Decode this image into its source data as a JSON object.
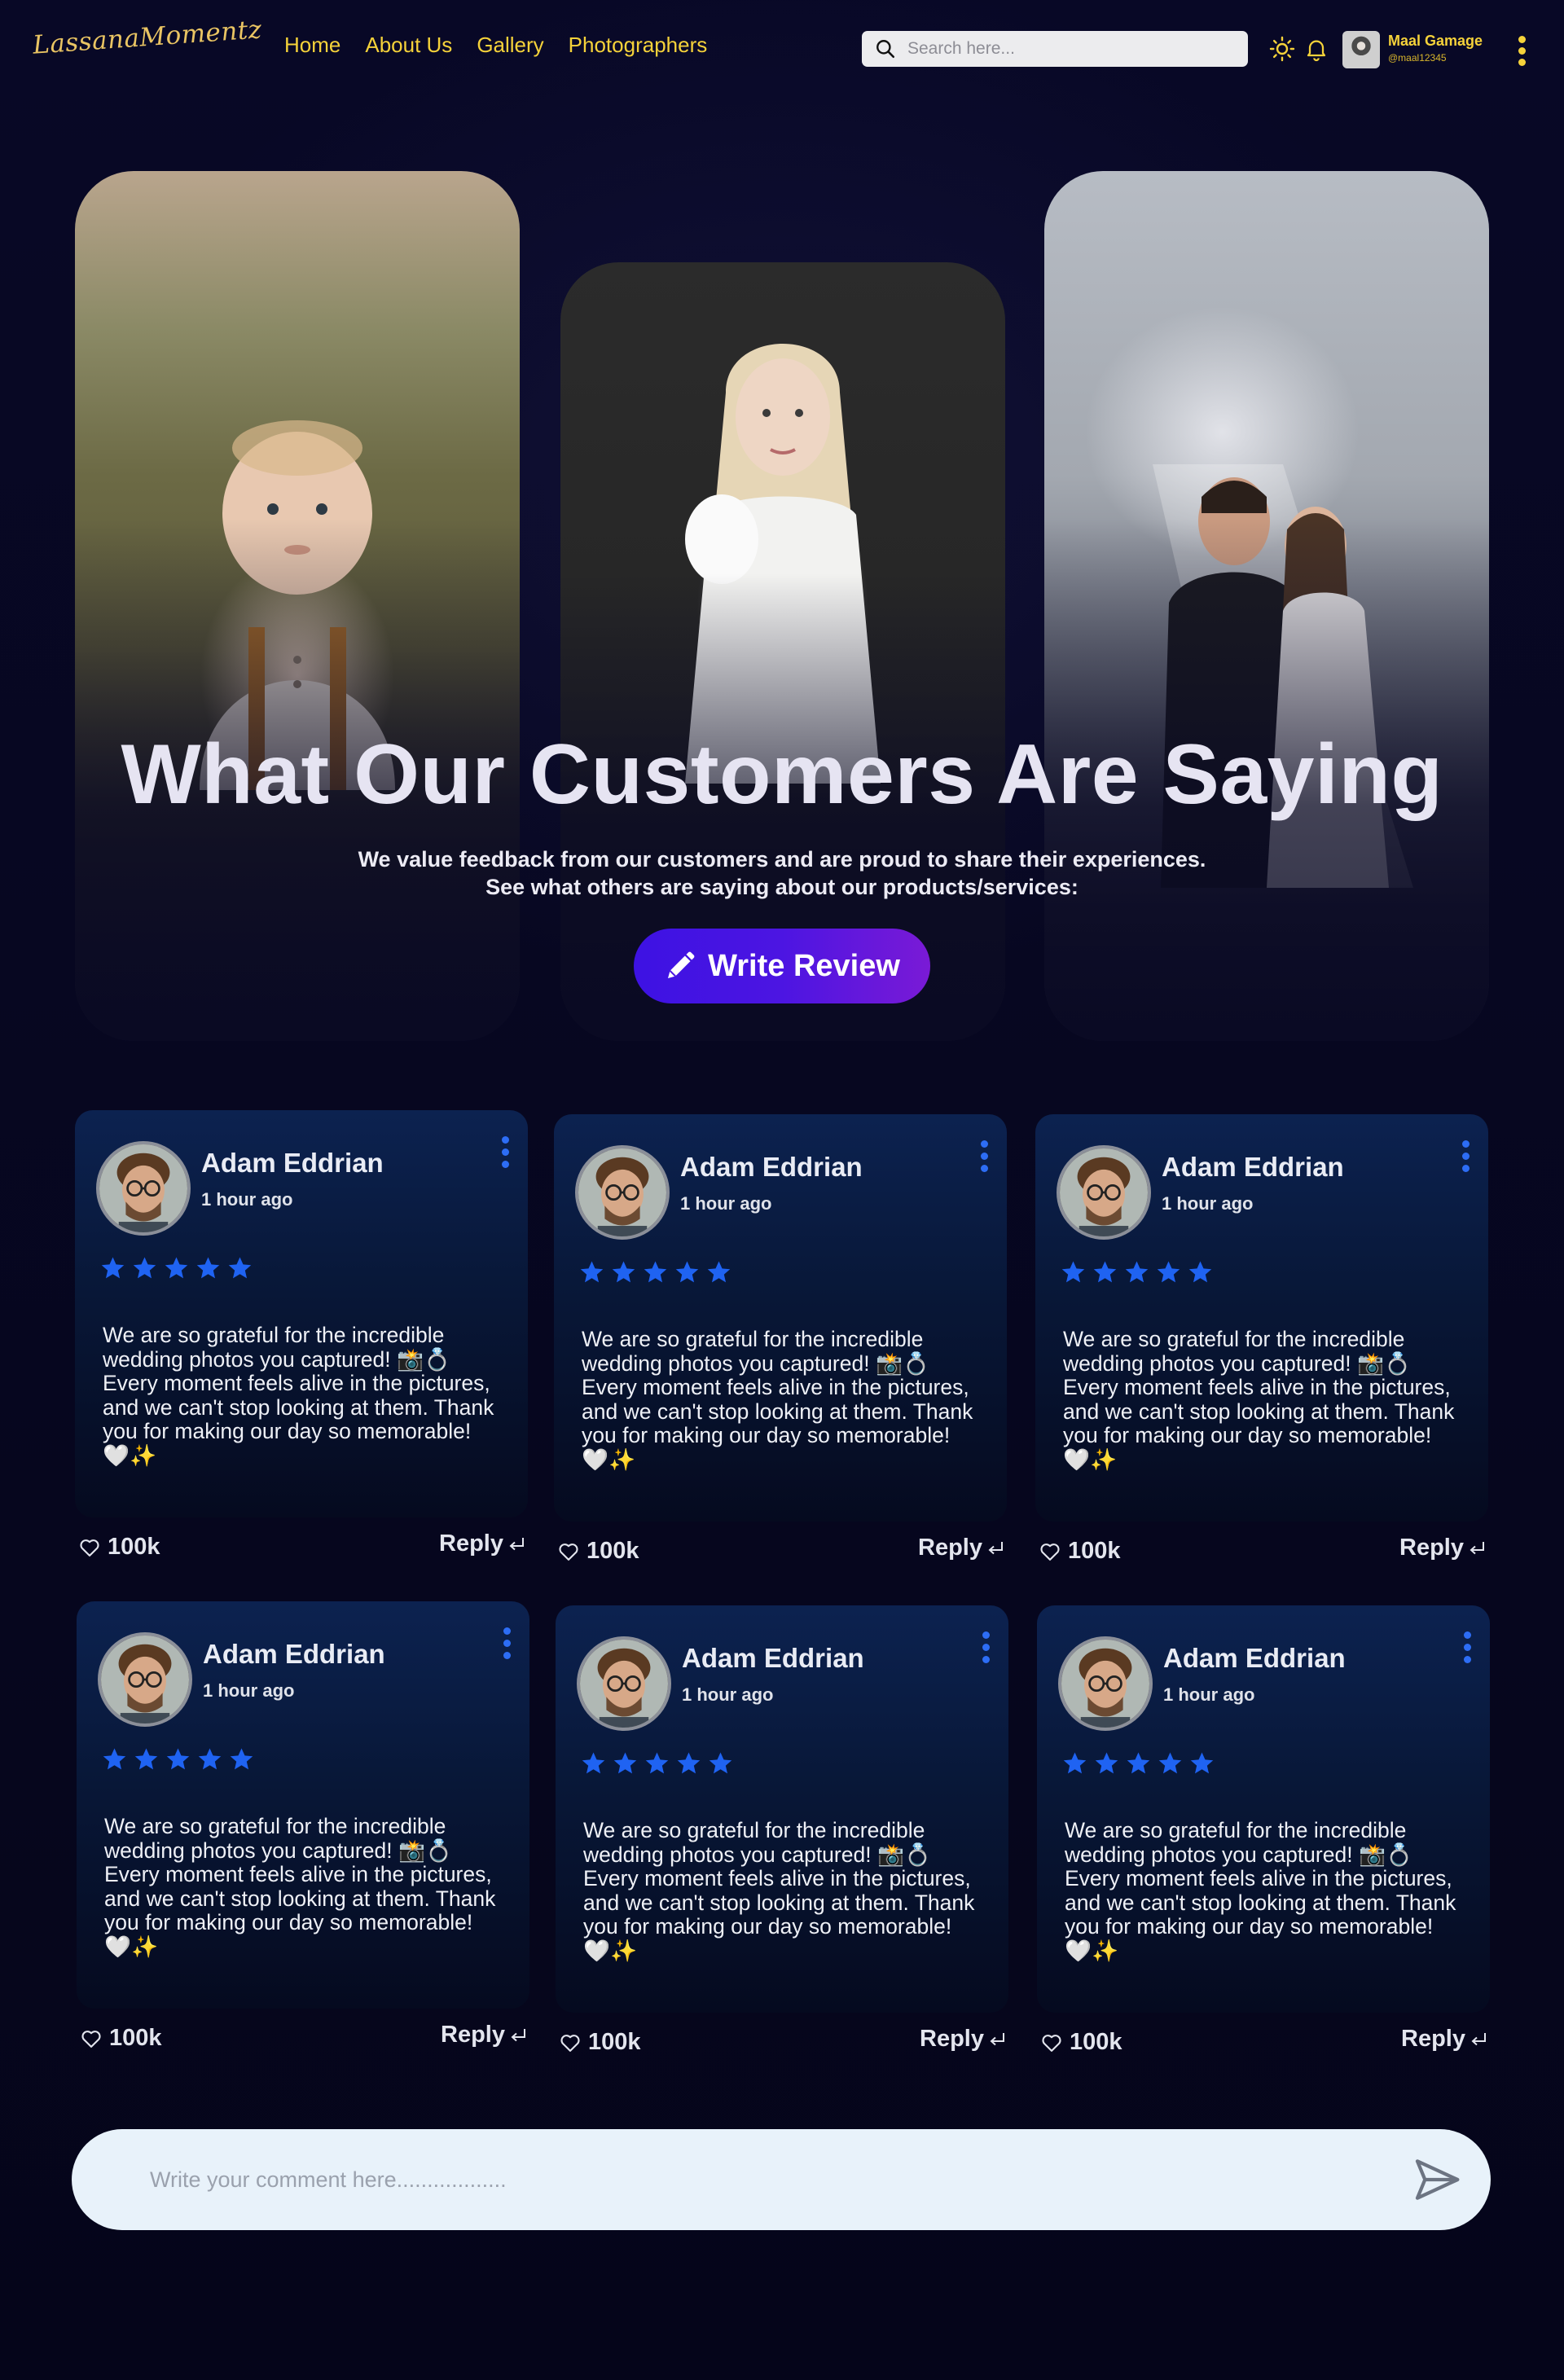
{
  "brand": {
    "logo_text": "LassanaMomentz"
  },
  "nav": {
    "links": [
      "Home",
      "About Us",
      "Gallery",
      "Photographers"
    ],
    "search_placeholder": "Search here...",
    "user_name": "Maal Gamage",
    "user_handle": "@maal12345",
    "icons": [
      "search-icon",
      "sun-icon",
      "bell-icon",
      "kebab-menu-icon"
    ],
    "accent_color": "#f5d23a"
  },
  "hero": {
    "title": "What Our Customers Are Saying",
    "subtitle_line1": "We value feedback from our customers and are proud to share their experiences.",
    "subtitle_line2": "See what others are saying about our products/services:",
    "button_label": "Write Review",
    "button_icon": "pencil-icon",
    "photos": [
      "baby portrait",
      "woman in white dress",
      "wedding couple"
    ]
  },
  "reviews": [
    {
      "name": "Adam Eddrian",
      "time": "1 hour ago",
      "rating": 5,
      "text": "We are so grateful for the incredible wedding photos you captured! 📸💍 Every moment feels alive in the pic­tures, and we can't stop looking at them. Thank you for making our day so memorable! 🤍✨",
      "likes": "100k",
      "reply_label": "Reply"
    },
    {
      "name": "Adam Eddrian",
      "time": "1 hour ago",
      "rating": 5,
      "text": "We are so grateful for the incredible wedding photos you captured! 📸💍 Every moment feels alive in the pic­tures, and we can't stop looking at them. Thank you for making our day so memorable! 🤍✨",
      "likes": "100k",
      "reply_label": "Reply"
    },
    {
      "name": "Adam Eddrian",
      "time": "1 hour ago",
      "rating": 5,
      "text": "We are so grateful for the incredible wedding photos you captured! 📸💍 Every moment feels alive in the pic­tures, and we can't stop looking at them. Thank you for making our day so memorable! 🤍✨",
      "likes": "100k",
      "reply_label": "Reply"
    },
    {
      "name": "Adam Eddrian",
      "time": "1 hour ago",
      "rating": 5,
      "text": "We are so grateful for the incredible wedding photos you captured! 📸💍 Every moment feels alive in the pic­tures, and we can't stop looking at them. Thank you for making our day so memorable! 🤍✨",
      "likes": "100k",
      "reply_label": "Reply"
    },
    {
      "name": "Adam Eddrian",
      "time": "1 hour ago",
      "rating": 5,
      "text": "We are so grateful for the incredible wedding photos you captured! 📸💍 Every moment feels alive in the pic­tures, and we can't stop looking at them. Thank you for making our day so memorable! 🤍✨",
      "likes": "100k",
      "reply_label": "Reply"
    },
    {
      "name": "Adam Eddrian",
      "time": "1 hour ago",
      "rating": 5,
      "text": "We are so grateful for the incredible wedding photos you captured! 📸💍 Every moment feels alive in the pic­tures, and we can't stop looking at them. Thank you for making our day so memorable! 🤍✨",
      "likes": "100k",
      "reply_label": "Reply"
    }
  ],
  "comment": {
    "placeholder": "Write your comment here..................",
    "send_icon": "send-icon"
  },
  "colors": {
    "background": "#070721",
    "card": "#0c2250",
    "star": "#1f63f2",
    "button_gradient_start": "#3d12e3",
    "button_gradient_end": "#7a1ad6"
  }
}
